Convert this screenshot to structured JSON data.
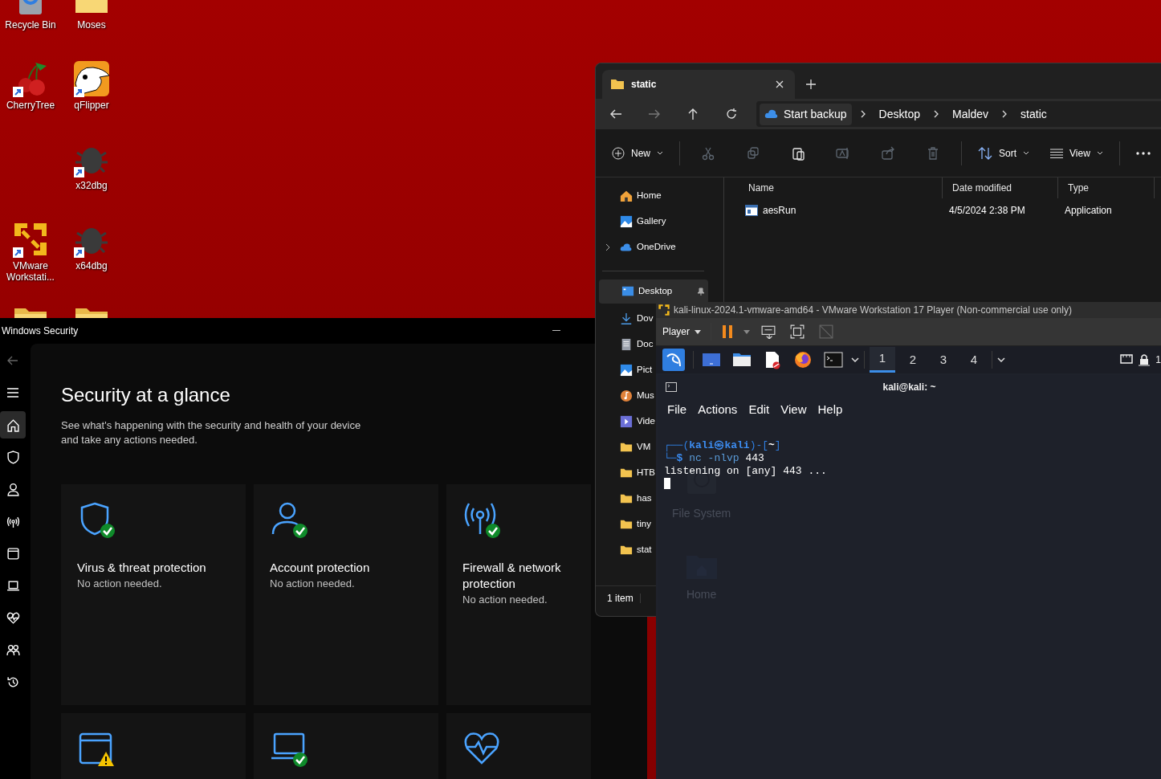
{
  "desktop": {
    "icons": [
      {
        "label": "Recycle Bin",
        "shortcut": false
      },
      {
        "label": "Moses",
        "shortcut": false
      },
      {
        "label": "CherryTree",
        "shortcut": true
      },
      {
        "label": "qFlipper",
        "shortcut": true
      },
      {
        "label": "x32dbg",
        "shortcut": true
      },
      {
        "label": "VMware Workstati...",
        "shortcut": true
      },
      {
        "label": "x64dbg",
        "shortcut": true
      }
    ]
  },
  "security": {
    "title": "Windows Security",
    "nav": [
      {
        "selected": true
      },
      {
        "selected": false
      },
      {
        "selected": false
      },
      {
        "selected": false
      },
      {
        "selected": false
      },
      {
        "selected": false
      },
      {
        "selected": false
      },
      {
        "selected": false
      },
      {
        "selected": false
      }
    ],
    "heading": "Security at a glance",
    "description": "See what's happening with the security and health of your device and take any actions needed.",
    "cards": [
      {
        "title": "Virus & threat protection",
        "status": "No action needed.",
        "checked": true,
        "warning": false
      },
      {
        "title": "Account protection",
        "status": "No action needed.",
        "checked": true,
        "warning": false
      },
      {
        "title": "Firewall & network protection",
        "status": "No action needed.",
        "checked": true,
        "warning": false
      },
      {
        "checked": false,
        "warning": true
      },
      {
        "checked": true,
        "warning": false
      },
      {
        "checked": false,
        "warning": false
      }
    ]
  },
  "explorer": {
    "tab": "static",
    "breadcrumb": [
      "Start backup",
      "Desktop",
      "Maldev",
      "static"
    ],
    "toolbar": {
      "new": "New",
      "icon_buttons": [
        {
          "disabled": true
        },
        {
          "disabled": true
        },
        {
          "disabled": false
        },
        {
          "disabled": true
        },
        {
          "disabled": true
        },
        {
          "disabled": true
        }
      ],
      "sort": "Sort",
      "view": "View"
    },
    "sidebar": [
      [
        {
          "label": "Home",
          "selected": false
        },
        {
          "label": "Gallery",
          "selected": false
        },
        {
          "label": "OneDrive",
          "selected": false,
          "expandable": true
        }
      ],
      [
        {
          "label": "Desktop",
          "selected": true,
          "pinned": true
        },
        {
          "label": "Dov",
          "selected": false
        },
        {
          "label": "Doc",
          "selected": false
        },
        {
          "label": "Pict",
          "selected": false
        },
        {
          "label": "Mus",
          "selected": false
        },
        {
          "label": "Vide",
          "selected": false
        },
        {
          "label": "VM",
          "selected": false
        },
        {
          "label": "HTB",
          "selected": false
        },
        {
          "label": "has",
          "selected": false
        },
        {
          "label": "tiny",
          "selected": false
        },
        {
          "label": "stat",
          "selected": false
        }
      ]
    ],
    "columns": [
      "Name",
      "Date modified",
      "Type"
    ],
    "rows": [
      {
        "name": "aesRun",
        "date": "4/5/2024 2:38 PM",
        "type": "Application"
      }
    ],
    "status": "1 item"
  },
  "vmware": {
    "title": "kali-linux-2024.1-vmware-amd64 - VMware Workstation 17 Player (Non-commercial use only)",
    "menu": "Player"
  },
  "kali": {
    "workspaces": [
      {
        "label": "1",
        "selected": true
      },
      {
        "label": "2",
        "selected": false
      },
      {
        "label": "3",
        "selected": false
      },
      {
        "label": "4",
        "selected": false
      }
    ],
    "clock": "1",
    "desktop_icons": [
      "File System",
      "Home"
    ],
    "terminal": {
      "title": "kali@kali: ~",
      "menu": [
        "File",
        "Actions",
        "Edit",
        "View",
        "Help"
      ],
      "lines": [
        [
          {
            "text": "┌──(",
            "kind": "frame"
          },
          {
            "text": "kali㉿kali",
            "kind": "user"
          },
          {
            "text": ")-[",
            "kind": "frame"
          },
          {
            "text": "~",
            "kind": "path"
          },
          {
            "text": "]",
            "kind": "frame"
          }
        ],
        [
          {
            "text": "└─",
            "kind": "frame"
          },
          {
            "text": "$ ",
            "kind": "user"
          },
          {
            "text": "nc -nlvp",
            "kind": "cmd"
          },
          {
            "text": " 443",
            "kind": "plain"
          }
        ],
        [
          {
            "text": "listening on [any] 443 ...",
            "kind": "plain"
          }
        ]
      ],
      "cursor": true
    }
  }
}
